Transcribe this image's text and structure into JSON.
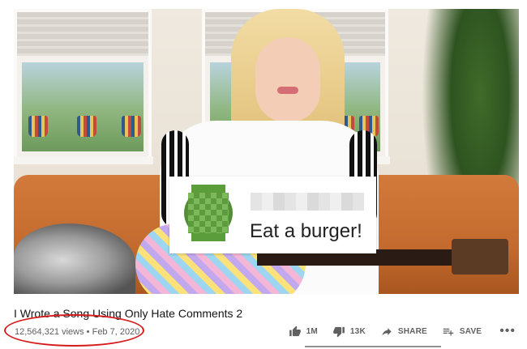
{
  "video": {
    "overlay_comment": "Eat a burger!"
  },
  "title": "I Wrote a Song Using Only Hate Comments 2",
  "stats": {
    "views": "12,564,321 views",
    "separator": " • ",
    "date": "Feb 7, 2020"
  },
  "actions": {
    "like_count": "1M",
    "dislike_count": "13K",
    "share_label": "SHARE",
    "save_label": "SAVE"
  },
  "icons": [
    "thumbs-up-icon",
    "thumbs-down-icon",
    "share-icon",
    "playlist-add-icon",
    "more-icon"
  ],
  "colors": {
    "annotation": "#d31b1b",
    "meta_text": "#606060"
  }
}
